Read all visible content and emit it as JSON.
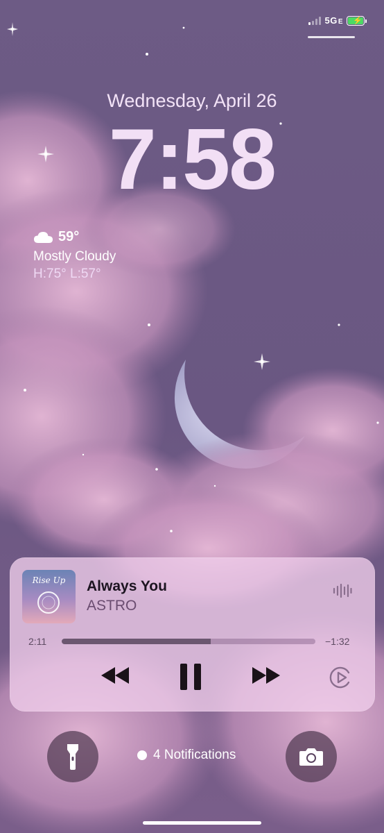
{
  "status_bar": {
    "network": "5G",
    "network_suffix": "E",
    "signal_bars": 4,
    "signal_active": 1,
    "battery_charging": true
  },
  "lock": {
    "date": "Wednesday, April 26",
    "time": "7:58"
  },
  "weather": {
    "temp": "59°",
    "condition": "Mostly Cloudy",
    "high_low": "H:75° L:57°",
    "icon": "cloud-icon"
  },
  "now_playing": {
    "album_art_text": "Rise Up",
    "title": "Always You",
    "artist": "ASTRO",
    "elapsed": "2:11",
    "remaining": "−1:32",
    "progress": 0.587
  },
  "bottom": {
    "notifications": "4 Notifications",
    "left_icon": "flashlight-icon",
    "right_icon": "camera-icon"
  },
  "colors": {
    "accent_text": "#f2dff5",
    "player_bg": "#f0cdeb",
    "battery": "#4cd964"
  }
}
